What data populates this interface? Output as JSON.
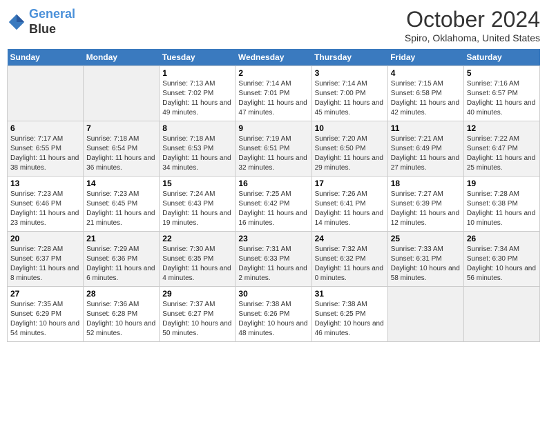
{
  "header": {
    "logo_line1": "General",
    "logo_line2": "Blue",
    "month": "October 2024",
    "location": "Spiro, Oklahoma, United States"
  },
  "weekdays": [
    "Sunday",
    "Monday",
    "Tuesday",
    "Wednesday",
    "Thursday",
    "Friday",
    "Saturday"
  ],
  "weeks": [
    [
      {
        "day": "",
        "info": ""
      },
      {
        "day": "",
        "info": ""
      },
      {
        "day": "1",
        "info": "Sunrise: 7:13 AM\nSunset: 7:02 PM\nDaylight: 11 hours and 49 minutes."
      },
      {
        "day": "2",
        "info": "Sunrise: 7:14 AM\nSunset: 7:01 PM\nDaylight: 11 hours and 47 minutes."
      },
      {
        "day": "3",
        "info": "Sunrise: 7:14 AM\nSunset: 7:00 PM\nDaylight: 11 hours and 45 minutes."
      },
      {
        "day": "4",
        "info": "Sunrise: 7:15 AM\nSunset: 6:58 PM\nDaylight: 11 hours and 42 minutes."
      },
      {
        "day": "5",
        "info": "Sunrise: 7:16 AM\nSunset: 6:57 PM\nDaylight: 11 hours and 40 minutes."
      }
    ],
    [
      {
        "day": "6",
        "info": "Sunrise: 7:17 AM\nSunset: 6:55 PM\nDaylight: 11 hours and 38 minutes."
      },
      {
        "day": "7",
        "info": "Sunrise: 7:18 AM\nSunset: 6:54 PM\nDaylight: 11 hours and 36 minutes."
      },
      {
        "day": "8",
        "info": "Sunrise: 7:18 AM\nSunset: 6:53 PM\nDaylight: 11 hours and 34 minutes."
      },
      {
        "day": "9",
        "info": "Sunrise: 7:19 AM\nSunset: 6:51 PM\nDaylight: 11 hours and 32 minutes."
      },
      {
        "day": "10",
        "info": "Sunrise: 7:20 AM\nSunset: 6:50 PM\nDaylight: 11 hours and 29 minutes."
      },
      {
        "day": "11",
        "info": "Sunrise: 7:21 AM\nSunset: 6:49 PM\nDaylight: 11 hours and 27 minutes."
      },
      {
        "day": "12",
        "info": "Sunrise: 7:22 AM\nSunset: 6:47 PM\nDaylight: 11 hours and 25 minutes."
      }
    ],
    [
      {
        "day": "13",
        "info": "Sunrise: 7:23 AM\nSunset: 6:46 PM\nDaylight: 11 hours and 23 minutes."
      },
      {
        "day": "14",
        "info": "Sunrise: 7:23 AM\nSunset: 6:45 PM\nDaylight: 11 hours and 21 minutes."
      },
      {
        "day": "15",
        "info": "Sunrise: 7:24 AM\nSunset: 6:43 PM\nDaylight: 11 hours and 19 minutes."
      },
      {
        "day": "16",
        "info": "Sunrise: 7:25 AM\nSunset: 6:42 PM\nDaylight: 11 hours and 16 minutes."
      },
      {
        "day": "17",
        "info": "Sunrise: 7:26 AM\nSunset: 6:41 PM\nDaylight: 11 hours and 14 minutes."
      },
      {
        "day": "18",
        "info": "Sunrise: 7:27 AM\nSunset: 6:39 PM\nDaylight: 11 hours and 12 minutes."
      },
      {
        "day": "19",
        "info": "Sunrise: 7:28 AM\nSunset: 6:38 PM\nDaylight: 11 hours and 10 minutes."
      }
    ],
    [
      {
        "day": "20",
        "info": "Sunrise: 7:28 AM\nSunset: 6:37 PM\nDaylight: 11 hours and 8 minutes."
      },
      {
        "day": "21",
        "info": "Sunrise: 7:29 AM\nSunset: 6:36 PM\nDaylight: 11 hours and 6 minutes."
      },
      {
        "day": "22",
        "info": "Sunrise: 7:30 AM\nSunset: 6:35 PM\nDaylight: 11 hours and 4 minutes."
      },
      {
        "day": "23",
        "info": "Sunrise: 7:31 AM\nSunset: 6:33 PM\nDaylight: 11 hours and 2 minutes."
      },
      {
        "day": "24",
        "info": "Sunrise: 7:32 AM\nSunset: 6:32 PM\nDaylight: 11 hours and 0 minutes."
      },
      {
        "day": "25",
        "info": "Sunrise: 7:33 AM\nSunset: 6:31 PM\nDaylight: 10 hours and 58 minutes."
      },
      {
        "day": "26",
        "info": "Sunrise: 7:34 AM\nSunset: 6:30 PM\nDaylight: 10 hours and 56 minutes."
      }
    ],
    [
      {
        "day": "27",
        "info": "Sunrise: 7:35 AM\nSunset: 6:29 PM\nDaylight: 10 hours and 54 minutes."
      },
      {
        "day": "28",
        "info": "Sunrise: 7:36 AM\nSunset: 6:28 PM\nDaylight: 10 hours and 52 minutes."
      },
      {
        "day": "29",
        "info": "Sunrise: 7:37 AM\nSunset: 6:27 PM\nDaylight: 10 hours and 50 minutes."
      },
      {
        "day": "30",
        "info": "Sunrise: 7:38 AM\nSunset: 6:26 PM\nDaylight: 10 hours and 48 minutes."
      },
      {
        "day": "31",
        "info": "Sunrise: 7:38 AM\nSunset: 6:25 PM\nDaylight: 10 hours and 46 minutes."
      },
      {
        "day": "",
        "info": ""
      },
      {
        "day": "",
        "info": ""
      }
    ]
  ]
}
